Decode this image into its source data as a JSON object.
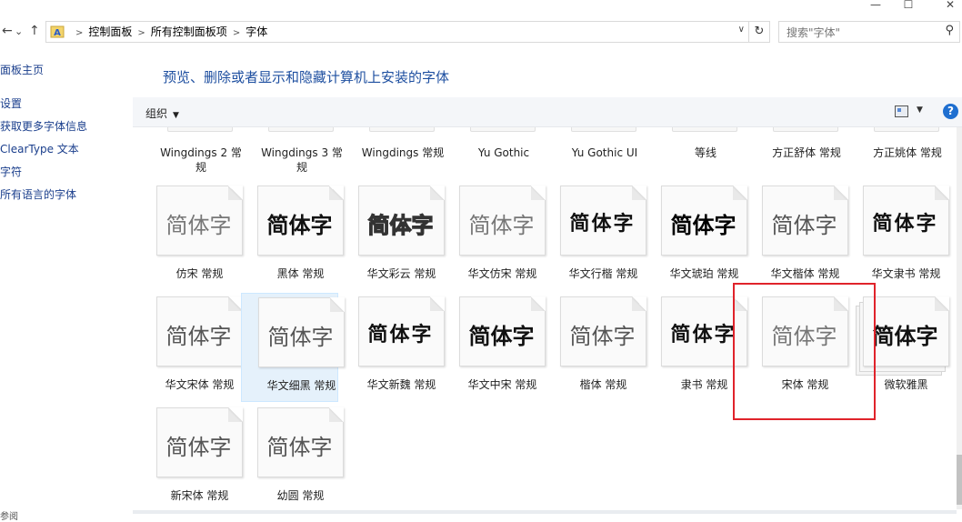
{
  "window": {
    "minimize": "—",
    "maximize": "☐",
    "close": "✕"
  },
  "nav": {
    "back": "←",
    "dropdown": "⌄",
    "up": "↑"
  },
  "breadcrumb": [
    "控制面板",
    "所有控制面板项",
    "字体"
  ],
  "search": {
    "placeholder": "搜索\"字体\""
  },
  "left_nav": [
    "面板主页",
    "设置",
    "获取更多字体信息",
    " ClearType 文本",
    "字符",
    "所有语言的字体"
  ],
  "title": "预览、删除或者显示和隐藏计算机上安装的字体",
  "toolbar": {
    "organize": "组织",
    "help": "?"
  },
  "sample_text": "简体字",
  "top_row": [
    "Wingdings 2 常规",
    "Wingdings 3 常规",
    "Wingdings 常规",
    "Yu Gothic",
    "Yu Gothic UI",
    "等线",
    "方正舒体 常规",
    "方正姚体 常规"
  ],
  "fonts": [
    {
      "label": "仿宋 常规",
      "style": "light"
    },
    {
      "label": "黑体 常规",
      "style": "bold"
    },
    {
      "label": "华文彩云 常规",
      "style": "outline"
    },
    {
      "label": "华文仿宋 常规",
      "style": "light"
    },
    {
      "label": "华文行楷 常规",
      "style": "script"
    },
    {
      "label": "华文琥珀 常规",
      "style": "heavy"
    },
    {
      "label": "华文楷体 常规",
      "style": "mid"
    },
    {
      "label": "华文隶书 常规",
      "style": "script"
    },
    {
      "label": "华文宋体 常规",
      "style": "mid"
    },
    {
      "label": "华文细黑 常规",
      "style": "mid",
      "selected": true
    },
    {
      "label": "华文新魏 常规",
      "style": "script"
    },
    {
      "label": "华文中宋 常规",
      "style": "bold"
    },
    {
      "label": "楷体 常规",
      "style": "mid"
    },
    {
      "label": "隶书 常规",
      "style": "script"
    },
    {
      "label": "宋体 常规",
      "style": "light"
    },
    {
      "label": "微软雅黑",
      "style": "bold",
      "stack": true
    },
    {
      "label": "新宋体 常规",
      "style": "mid"
    },
    {
      "label": "幼圆 常规",
      "style": "mid"
    }
  ],
  "status_bar": "参阅",
  "colors": {
    "link": "#1a3e8c",
    "title": "#1e4fa0",
    "highlight": "#e0232b",
    "selection": "#e5f1fb"
  }
}
